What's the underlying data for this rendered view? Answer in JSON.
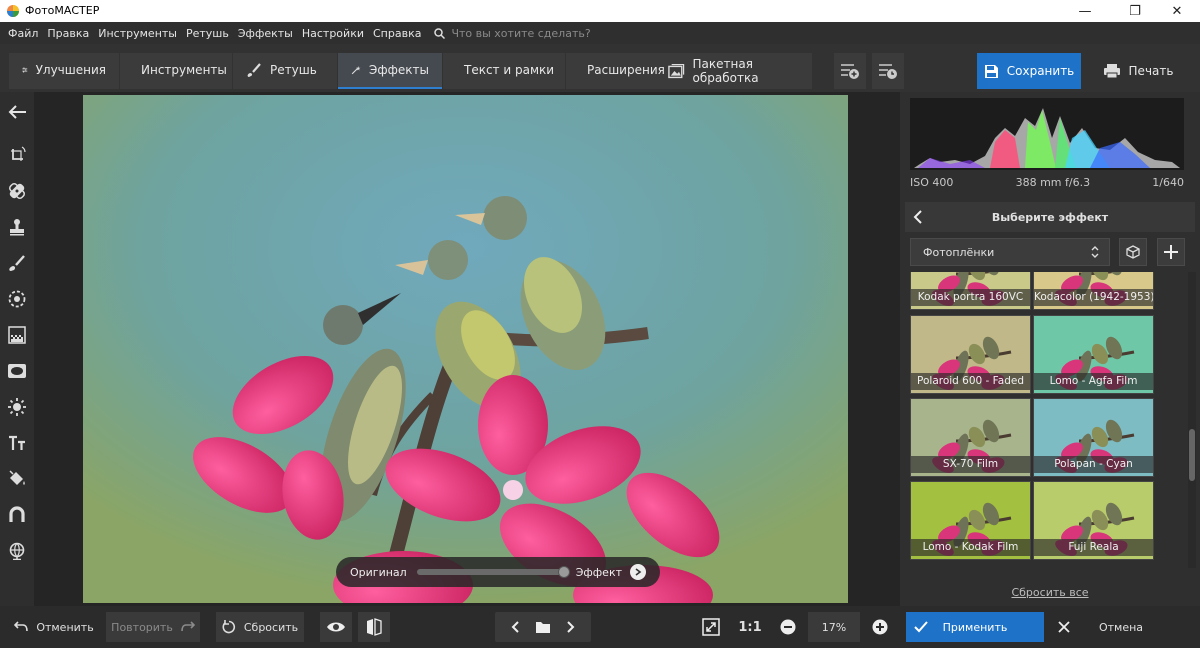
{
  "app": {
    "title": "ФотоМАСТЕР"
  },
  "window": {
    "minimize": "—",
    "maximize": "❐",
    "close": "✕"
  },
  "menu": {
    "items": [
      "Файл",
      "Правка",
      "Инструменты",
      "Ретушь",
      "Эффекты",
      "Настройки",
      "Справка"
    ],
    "search_placeholder": "Что вы хотите сделать?"
  },
  "toolbar": {
    "tabs": [
      {
        "label": "Улучшения",
        "icon": "sliders-icon"
      },
      {
        "label": "Инструменты",
        "icon": "crop-icon"
      },
      {
        "label": "Ретушь",
        "icon": "brush-icon"
      },
      {
        "label": "Эффекты",
        "icon": "magic-wand-icon",
        "active": true
      },
      {
        "label": "Текст и рамки",
        "icon": "text-icon"
      },
      {
        "label": "Расширения",
        "icon": "plus-icon"
      }
    ],
    "batch_label": "Пакетная обработка",
    "save_label": "Сохранить",
    "print_label": "Печать"
  },
  "left_tools": [
    "back-arrow-icon",
    "rotate-icon",
    "bandage-icon",
    "stamp-icon",
    "brush-icon",
    "radial-filter-icon",
    "gradient-icon",
    "vignette-icon",
    "sun-icon",
    "text-icon",
    "paint-bucket-icon",
    "magnet-icon",
    "globe-icon"
  ],
  "compare": {
    "original": "Оригинал",
    "effect": "Эффект"
  },
  "histogram": {
    "iso": "ISO 400",
    "lens": "388 mm f/6.3",
    "shutter": "1/640"
  },
  "effects_panel": {
    "title": "Выберите эффект",
    "category": "Фотоплёнки",
    "items": [
      {
        "label": "Kodak portra 160VC",
        "tint": "#c9c98a"
      },
      {
        "label": "Kodacolor (1942-1953)",
        "tint": "#d8c98a"
      },
      {
        "label": "Polaroid 600 - Faded",
        "tint": "#c0b888"
      },
      {
        "label": "Lomo - Agfa Film",
        "tint": "#6ec8a8"
      },
      {
        "label": "SX-70 Film",
        "tint": "#a8b48c"
      },
      {
        "label": "Polapan - Cyan",
        "tint": "#7ebcc4"
      },
      {
        "label": "Lomo - Kodak Film",
        "tint": "#a4c040"
      },
      {
        "label": "Fuji Reala",
        "tint": "#b9cc6c"
      }
    ],
    "reset_all": "Сбросить все"
  },
  "bottom": {
    "undo": "Отменить",
    "redo": "Повторить",
    "reset": "Сбросить",
    "actual_size": "1:1",
    "zoom": "17%",
    "apply": "Применить",
    "cancel": "Отмена"
  },
  "colors": {
    "accent": "#1e73c8",
    "bg": "#2b2b2b",
    "panel": "#2f2f2f"
  }
}
